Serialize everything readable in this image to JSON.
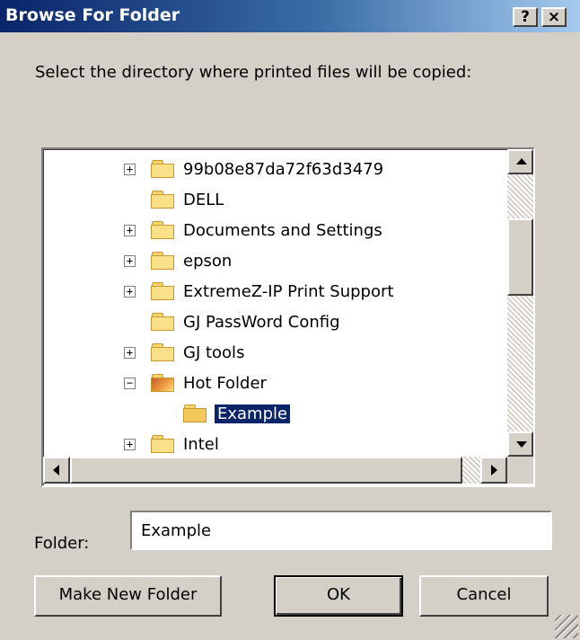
{
  "window": {
    "title": "Browse For Folder",
    "help_glyph": "?",
    "close_glyph": "×"
  },
  "instruction": "Select the directory where printed files will be copied:",
  "tree": {
    "nodes": [
      {
        "label": "99b08e87da72f63d3479",
        "expander": "+"
      },
      {
        "label": "DELL",
        "expander": ""
      },
      {
        "label": "Documents and Settings",
        "expander": "+"
      },
      {
        "label": "epson",
        "expander": "+"
      },
      {
        "label": "ExtremeZ-IP Print Support",
        "expander": "+"
      },
      {
        "label": "GJ PassWord Config",
        "expander": ""
      },
      {
        "label": "GJ tools",
        "expander": "+"
      },
      {
        "label": "Hot Folder",
        "expander": "−",
        "icon": "hot-folder-icon"
      },
      {
        "label": "Example",
        "expander": "",
        "selected": true,
        "icon": "open-folder-icon"
      },
      {
        "label": "Intel",
        "expander": "+"
      }
    ]
  },
  "folder_field": {
    "label": "Folder:",
    "value": "Example"
  },
  "buttons": {
    "make_new_folder": "Make New Folder",
    "ok": "OK",
    "cancel": "Cancel"
  },
  "colors": {
    "face": "#d4d0c8",
    "title_start": "#0a246a",
    "title_end": "#a6caf0",
    "selection": "#0a246a"
  }
}
